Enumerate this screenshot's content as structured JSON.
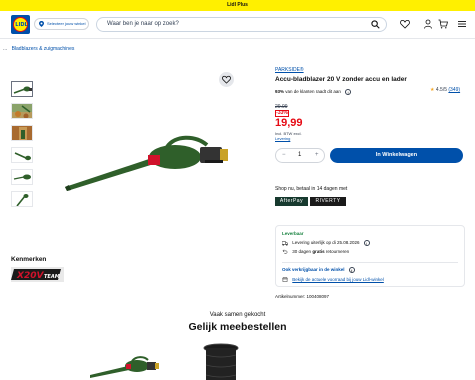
{
  "promo": {
    "text": "Lidl Plus"
  },
  "header": {
    "logo_text": "LIDL",
    "store_label": "Selecteer jouw winkel",
    "search_placeholder": "Waar ben je naar op zoek?"
  },
  "breadcrumb": {
    "dots": "...",
    "link": "Bladblazers & zuigmachines"
  },
  "product": {
    "brand": "PARKSIDE®",
    "title": "Accu-bladblazer 20 V zonder accu en lader",
    "recommend_pct": "93%",
    "recommend_text": "van de klanten raadt dit aan",
    "rating_value": "4.5/5",
    "rating_count": "(349)",
    "old_price": "29.99",
    "discount": "-33%",
    "price": "19,99",
    "vat_line1": "Incl. BTW excl.",
    "vat_link": "Levering",
    "qty": "1",
    "qty_minus": "−",
    "qty_plus": "+",
    "cart_button": "In Winkelwagen",
    "shop_now": "Shop nu, betaal in 14 dagen met",
    "pay_a": "AfterPay",
    "pay_b": "RIVERTY",
    "availability": "Leverbaar",
    "delivery_line": "Levering uiterlijk op di 25.08.2026",
    "returns_prefix": "30 dagen",
    "returns_bold": "gratis",
    "returns_suffix": "retourneren",
    "store_check_title": "Ook verkrijgbaar in de winkel",
    "store_check_link": "Bekijk de actuele voorraad bij jouw Lidl-winkel",
    "article_nr": "Artikelnummer: 100408097"
  },
  "features": {
    "title": "Kenmerken",
    "badge": "X20V TEAM"
  },
  "recommendations": {
    "subtitle": "Vaak samen gekocht",
    "title": "Gelijk meebestellen"
  },
  "colors": {
    "brand_blue": "#0050aa",
    "promo_yellow": "#fff000",
    "price_red": "#e60a14",
    "tool_green": "#2f5f2a"
  }
}
